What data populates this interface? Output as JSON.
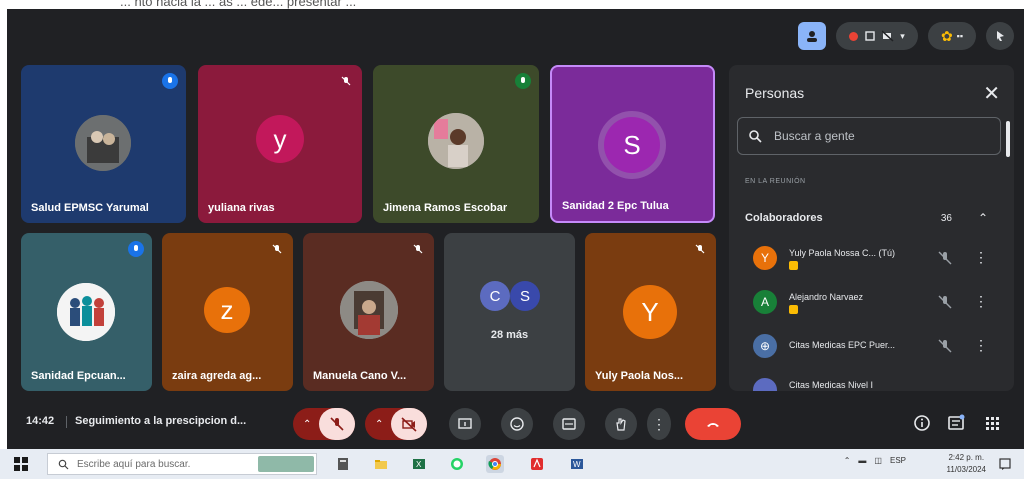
{
  "meeting": {
    "time": "14:42",
    "title": "Seguimiento a la prescipcion d...",
    "tiles": [
      {
        "name": "Salud EPMSC Yarumal",
        "bg": "#1e3a6e",
        "avatar_type": "photo"
      },
      {
        "name": "yuliana rivas",
        "bg": "#8b1a3c",
        "avatar_letter": "y",
        "avatar_color": "#c2185b"
      },
      {
        "name": "Jimena Ramos Escobar",
        "bg": "#3d4a2a",
        "avatar_type": "photo"
      },
      {
        "name": "Sanidad 2 Epc Tulua",
        "bg": "#7b2b9a",
        "avatar_letter": "S",
        "avatar_color": "#9c27b0"
      },
      {
        "name": "Sanidad Epcuan...",
        "bg": "#355f69",
        "avatar_type": "photo"
      },
      {
        "name": "zaira agreda ag...",
        "bg": "#7a3c10",
        "avatar_letter": "z",
        "avatar_color": "#e8710a"
      },
      {
        "name": "Manuela Cano V...",
        "bg": "#5a2c22",
        "avatar_type": "photo"
      },
      {
        "name": "",
        "bg": "#3c4043",
        "more_label": "28 más",
        "letters": [
          "C",
          "S"
        ]
      },
      {
        "name": "Yuly Paola Nos...",
        "bg": "#7a3c10",
        "avatar_letter": "Y",
        "avatar_color": "#e8710a"
      }
    ]
  },
  "people_panel": {
    "title": "Personas",
    "search_placeholder": "Buscar a gente",
    "section_label": "EN LA REUNIÓN",
    "group_label": "Colaboradores",
    "group_count": "36",
    "people": [
      {
        "name": "Yuly Paola Nossa C... (Tú)",
        "letter": "Y",
        "color": "#e8710a",
        "has_tag": true
      },
      {
        "name": "Alejandro Narvaez",
        "letter": "A",
        "color": "#188038",
        "has_tag": true
      },
      {
        "name": "Citas Medicas EPC Puer...",
        "letter": "⊕",
        "color": "#4a6fa5",
        "has_tag": false
      },
      {
        "name": "Citas Medicas Nivel I",
        "letter": "",
        "color": "#5c6bc0",
        "has_tag": false
      }
    ]
  },
  "taskbar": {
    "search_placeholder": "Escribe aquí para buscar.",
    "clock_time": "2:42 p. m.",
    "clock_date": "11/03/2024",
    "tray_lang": "ESP"
  },
  "caption_text": "... nto hacia la ... as ... ede... presentar ..."
}
